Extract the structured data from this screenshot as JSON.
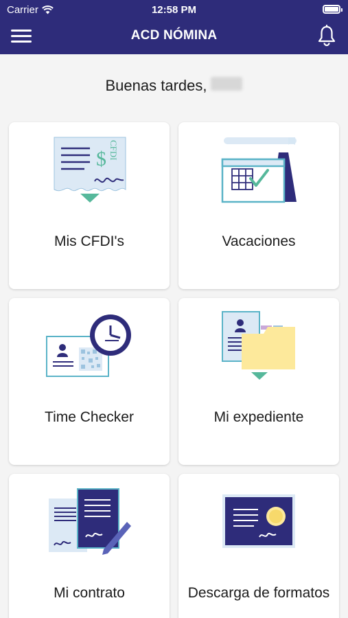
{
  "status_bar": {
    "carrier": "Carrier",
    "time": "12:58 PM"
  },
  "header": {
    "title": "ACD NÓMINA",
    "menu_icon": "menu-icon",
    "notifications_icon": "bell-icon"
  },
  "greeting": {
    "text": "Buenas tardes,"
  },
  "colors": {
    "header_bg": "#2e2c7a",
    "navy": "#2e2c7a",
    "light_blue": "#dce9f5",
    "teal": "#5ab3c7",
    "green": "#56b89b",
    "yellow": "#fde99b"
  },
  "cards": [
    {
      "label": "Mis CFDI's",
      "icon": "receipt-cfdi-icon",
      "icon_text": "CFDI",
      "currency": "$"
    },
    {
      "label": "Vacaciones",
      "icon": "calendar-check-icon"
    },
    {
      "label": "Time Checker",
      "icon": "id-card-clock-icon"
    },
    {
      "label": "Mi expediente",
      "icon": "folder-file-icon"
    },
    {
      "label": "Mi contrato",
      "icon": "contract-sign-icon"
    },
    {
      "label": "Descarga de formatos",
      "icon": "certificate-download-icon"
    }
  ]
}
